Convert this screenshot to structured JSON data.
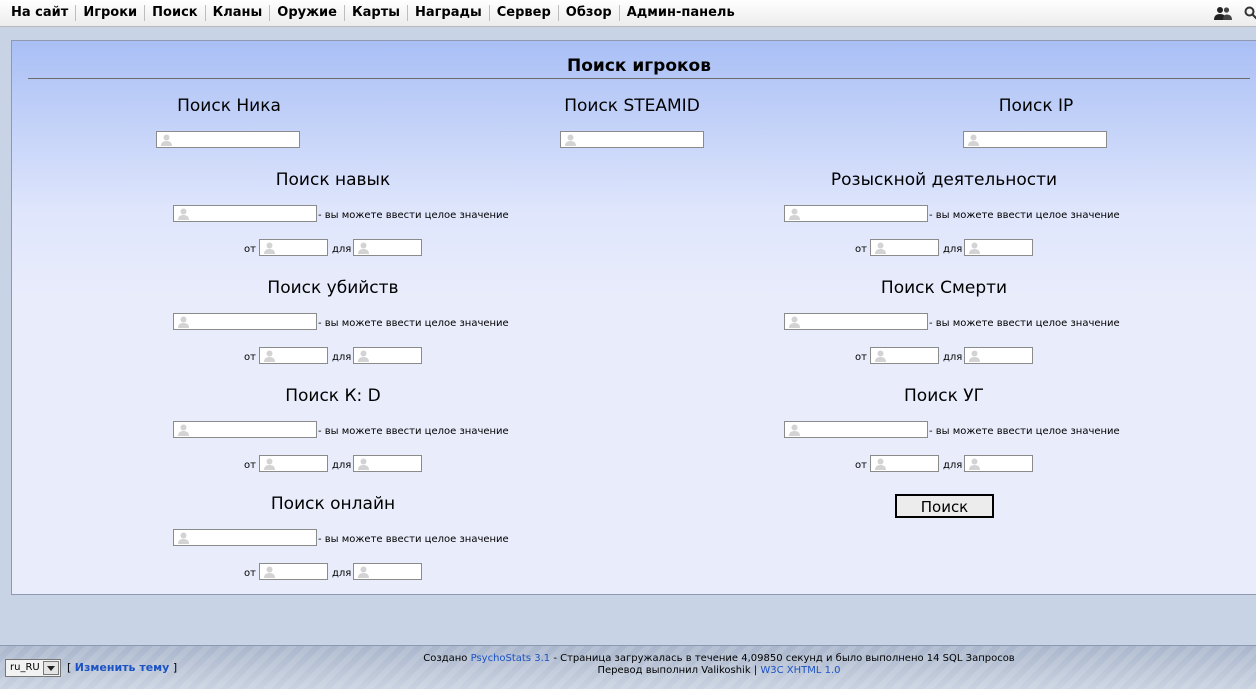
{
  "nav": {
    "items": [
      "На сайт",
      "Игроки",
      "Поиск",
      "Кланы",
      "Оружие",
      "Карты",
      "Награды",
      "Сервер",
      "Обзор",
      "Админ-панель"
    ]
  },
  "page_title": "Поиск игроков",
  "search": {
    "nick_heading": "Поиск Ника",
    "steamid_heading": "Поиск STEAMID",
    "ip_heading": "Поиск IP",
    "skill_heading": "Поиск навык",
    "activity_heading": "Розыскной деятельности",
    "kills_heading": "Поиск убийств",
    "deaths_heading": "Поиск Смерти",
    "kd_heading": "Поиск К: D",
    "hs_heading": "Поиск УГ",
    "online_heading": "Поиск онлайн",
    "hint": "- вы можете ввести целое значение",
    "from_label": "от",
    "to_label": "для",
    "button_label": "Поиск"
  },
  "footer": {
    "lang_value": "ru_RU",
    "bracket_open": "[",
    "change_theme": "Изменить тему",
    "bracket_close": "]",
    "created_prefix": "Создано",
    "psychostats_link": "PsychoStats 3.1",
    "load_info": "- Страница загружалась в течение 4,09850 секунд и было выполнено 14 SQL Запросов",
    "translation": "Перевод выполнил Valikoshik |",
    "w3c_link": "W3C XHTML 1.0"
  },
  "colors": {
    "panel_top": "#a9bff5",
    "panel_bottom": "#e9ecfb",
    "link": "#1c52c4"
  }
}
